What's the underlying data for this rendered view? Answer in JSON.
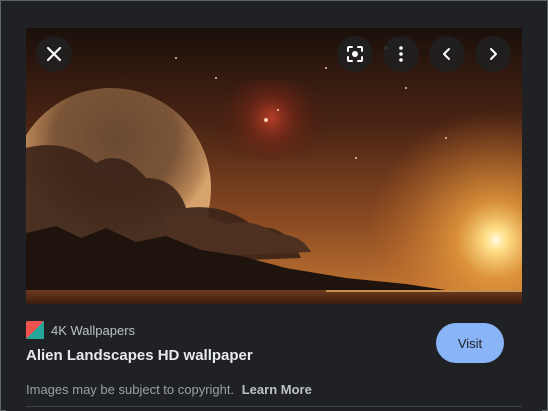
{
  "image": {
    "subject": "alien-landscape-wallpaper"
  },
  "controls": {
    "close_icon": "close-icon",
    "lens_icon": "google-lens-icon",
    "more_icon": "more-vert-icon",
    "prev_icon": "chevron-left-icon",
    "next_icon": "chevron-right-icon"
  },
  "source": {
    "name": "4K Wallpapers",
    "favicon_colors": [
      "#ef5350",
      "#26a69a"
    ]
  },
  "title": "Alien Landscapes HD wallpaper",
  "visit_label": "Visit",
  "copyright": {
    "text": "Images may be subject to copyright.",
    "learn_more": "Learn More"
  },
  "colors": {
    "background": "#202124",
    "visit_button": "#8ab4f8",
    "control_background": "#202124"
  }
}
